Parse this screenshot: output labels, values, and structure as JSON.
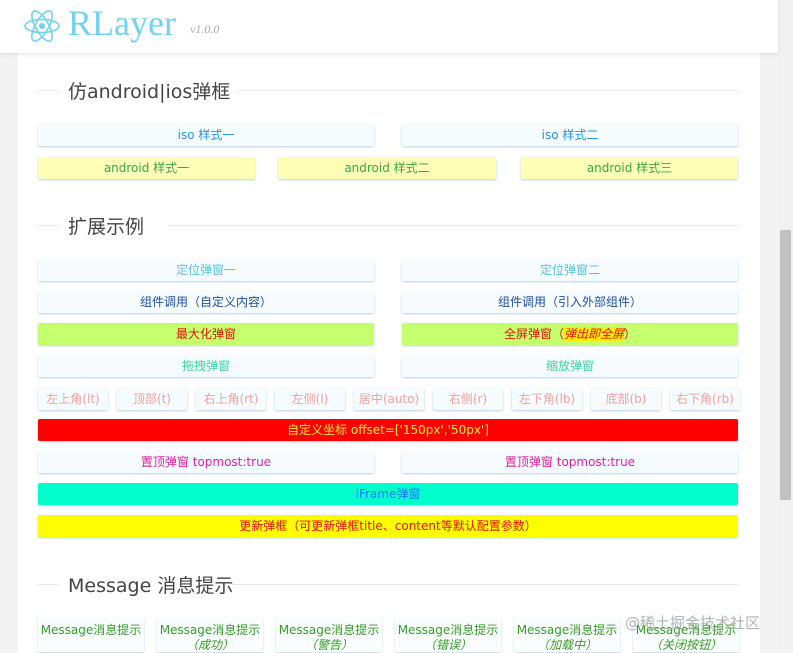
{
  "header": {
    "brand": "RLayer",
    "version": "v1.0.0"
  },
  "sections": {
    "s1": "仿android|ios弹框",
    "s2": "扩展示例",
    "s3": "Message 消息提示"
  },
  "ios": [
    "iso 样式一",
    "iso 样式二"
  ],
  "android": [
    "android 样式一",
    "android 样式二",
    "android 样式三"
  ],
  "ext": {
    "pos1": "定位弹窗一",
    "pos2": "定位弹窗二",
    "comp1": "组件调用（自定义内容）",
    "comp2": "组件调用（引入外部组件）",
    "max": "最大化弹窗",
    "full": "全屏弹窗（",
    "full_em": "弹出即全屏",
    "full_end": "）",
    "drag": "拖拽弹窗",
    "resize": "缩放弹窗",
    "dirs": [
      "左上角(lt)",
      "顶部(t)",
      "右上角(rt)",
      "左侧(l)",
      "居中(auto)",
      "右侧(r)",
      "左下角(lb)",
      "底部(b)",
      "右下角(rb)"
    ],
    "offset": "自定义坐标 offset=['150px','50px']",
    "top1": "置顶弹窗 topmost:true",
    "top2": "置顶弹窗 topmost:true",
    "iframe": "iFrame弹窗",
    "update": "更新弹框（可更新弹框title、content等默认配置参数）"
  },
  "messages": [
    {
      "label": "Message消息提示",
      "sub": ""
    },
    {
      "label": "Message消息提示",
      "sub": "（成功）"
    },
    {
      "label": "Message消息提示",
      "sub": "（警告）"
    },
    {
      "label": "Message消息提示",
      "sub": "（错误）"
    },
    {
      "label": "Message消息提示",
      "sub": "（加载中）"
    },
    {
      "label": "Message消息提示",
      "sub": "（关闭按钮）"
    }
  ],
  "watermark": "@稀土掘金技术社区"
}
